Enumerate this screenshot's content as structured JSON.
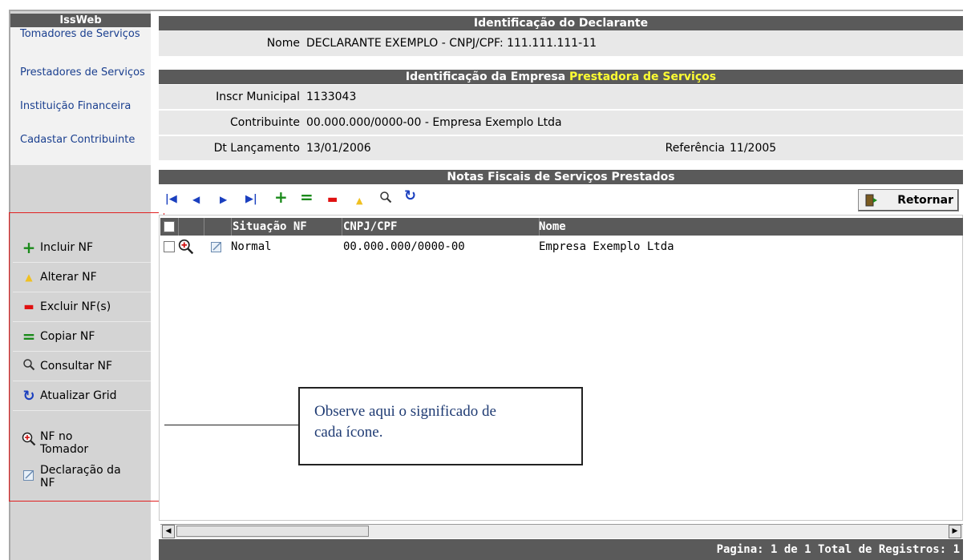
{
  "sidebar": {
    "title": "IssWeb",
    "links": [
      "Tomadores de Serviços",
      "Prestadores de Serviços",
      "Instituição Financeira",
      "Cadastar Contribuinte"
    ],
    "actions": [
      {
        "icon": "plus-icon",
        "glyph": "+",
        "color": "#1a8a1a",
        "label": "Incluir NF"
      },
      {
        "icon": "triangle-up-icon",
        "glyph": "▲",
        "color": "#f0c020",
        "label": "Alterar NF"
      },
      {
        "icon": "minus-icon",
        "glyph": "▬",
        "color": "#e01010",
        "label": "Excluir NF(s)"
      },
      {
        "icon": "equals-icon",
        "glyph": "=",
        "color": "#1a8a1a",
        "label": "Copiar NF"
      },
      {
        "icon": "search-icon",
        "glyph": "🔍︎",
        "color": "#333333",
        "label": "Consultar NF"
      },
      {
        "icon": "refresh-icon",
        "glyph": "↻",
        "color": "#1a3fbf",
        "label": "Atualizar Grid"
      }
    ],
    "legend": [
      {
        "icon": "magnify-plus-icon",
        "label_line1": "NF no",
        "label_line2": "Tomador"
      },
      {
        "icon": "declaration-icon",
        "label_line1": "Declaração da",
        "label_line2": "NF"
      }
    ]
  },
  "declarante": {
    "section_title": "Identificação do Declarante",
    "nome_label": "Nome",
    "nome_value": "DECLARANTE EXEMPLO - CNPJ/CPF: 111.111.111-11"
  },
  "empresa": {
    "section_title_prefix": "Identificação da Empresa",
    "section_title_highlight": "Prestadora de Serviços",
    "highlight_color": "#ffff33",
    "inscr_label": "Inscr Municipal",
    "inscr_value": "1133043",
    "contribuinte_label": "Contribuinte",
    "contribuinte_value": "00.000.000/0000-00 - Empresa Exemplo Ltda",
    "dt_label": "Dt Lançamento",
    "dt_value": "13/01/2006",
    "ref_label": "Referência",
    "ref_value": "11/2005"
  },
  "notas": {
    "section_title": "Notas Fiscais de Serviços Prestados",
    "toolbar": [
      "first-icon",
      "prev-icon",
      "next-icon",
      "last-icon",
      "plus-icon",
      "equals-icon",
      "minus-icon",
      "triangle-up-icon",
      "search-icon",
      "refresh-icon"
    ],
    "return_label": "Retornar",
    "columns": [
      "Situação NF",
      "CNPJ/CPF",
      "Nome"
    ],
    "rows": [
      {
        "situacao": "Normal",
        "cnpj": "00.000.000/0000-00",
        "nome": "Empresa Exemplo Ltda"
      }
    ],
    "status_text": "Pagina: 1 de 1 Total de Registros: 1"
  },
  "callout": {
    "text_line1": "Observe aqui o significado de",
    "text_line2": "cada ícone."
  }
}
